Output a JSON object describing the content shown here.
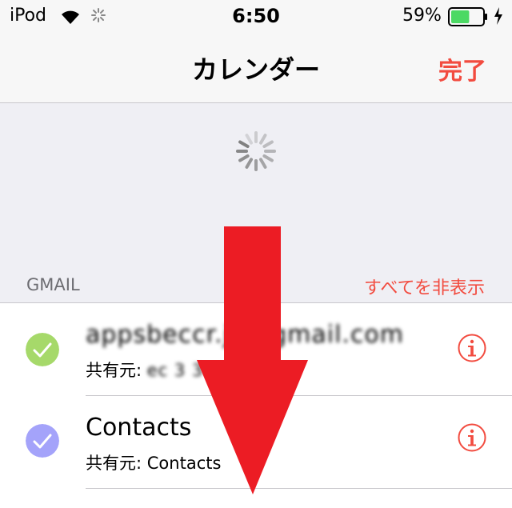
{
  "status_bar": {
    "device": "iPod",
    "time": "6:50",
    "battery_percent": "59%",
    "battery_level": 0.59,
    "battery_color": "#4cd964",
    "icons": [
      "wifi-icon",
      "activity-spinner-icon",
      "battery-icon",
      "charging-bolt-icon"
    ]
  },
  "nav": {
    "title": "カレンダー",
    "done_label": "完了",
    "accent_color": "#f24b3f"
  },
  "section": {
    "title": "GMAIL",
    "hide_all_label": "すべてを非表示"
  },
  "calendars": [
    {
      "name": "appsbeccr.jp@gmail.com",
      "shared_prefix": "共有元: ",
      "shared_value": "ec 3 3 e a",
      "obscured": true,
      "color": "#a6d96a",
      "checked": true
    },
    {
      "name": "Contacts",
      "shared_prefix": "共有元: ",
      "shared_value": "Contacts",
      "obscured": false,
      "color": "#a4a3fa",
      "checked": true
    }
  ],
  "overlay": {
    "type": "down-arrow",
    "color": "#ec1c24"
  }
}
